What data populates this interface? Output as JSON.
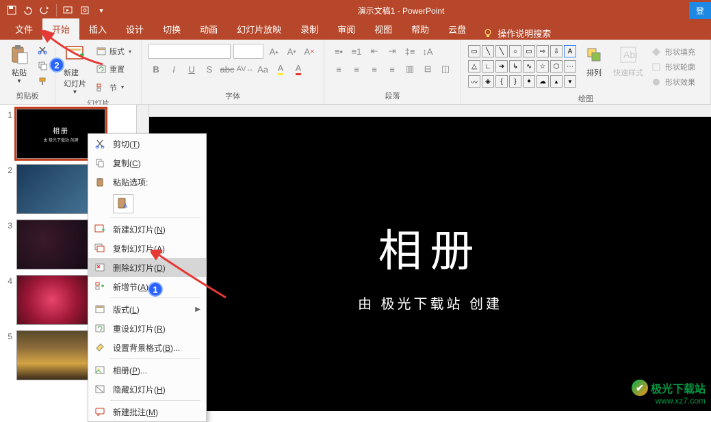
{
  "titlebar": {
    "title": "演示文稿1 - PowerPoint",
    "login": "登"
  },
  "tabs": {
    "file": "文件",
    "home": "开始",
    "insert": "插入",
    "design": "设计",
    "transitions": "切换",
    "animations": "动画",
    "slideshow": "幻灯片放映",
    "record": "录制",
    "review": "审阅",
    "view": "视图",
    "help": "帮助",
    "cloud": "云盘",
    "tellme": "操作说明搜索"
  },
  "ribbon": {
    "clipboard": {
      "label": "剪贴板",
      "paste": "粘贴"
    },
    "slides": {
      "label": "幻灯片",
      "newslide": "新建\n幻灯片",
      "layout": "版式",
      "reset": "重置",
      "section": "节"
    },
    "font": {
      "label": "字体"
    },
    "paragraph": {
      "label": "段落"
    },
    "drawing": {
      "label": "绘图",
      "arrange": "排列",
      "quickstyles": "快速样式",
      "fill": "形状填充",
      "outline": "形状轮廓",
      "effects": "形状效果"
    }
  },
  "slides": [
    {
      "num": "1",
      "title": "相册",
      "sub": "由 极光下载站 创建"
    },
    {
      "num": "2"
    },
    {
      "num": "3"
    },
    {
      "num": "4"
    },
    {
      "num": "5"
    }
  ],
  "canvas": {
    "title": "相册",
    "subtitle": "由 极光下载站 创建"
  },
  "ctx": {
    "cut": "剪切",
    "cut_k": "T",
    "copy": "复制",
    "copy_k": "C",
    "pasteopts": "粘贴选项:",
    "newslide": "新建幻灯片",
    "newslide_k": "N",
    "dupslide": "复制幻灯片",
    "dupslide_k": "A",
    "delslide": "删除幻灯片",
    "delslide_k": "D",
    "addsection": "新增节",
    "addsection_k": "A",
    "layout": "版式",
    "layout_k": "L",
    "resetslide": "重设幻灯片",
    "resetslide_k": "R",
    "formatbg": "设置背景格式",
    "formatbg_k": "B",
    "album": "相册",
    "album_k": "P",
    "hideslide": "隐藏幻灯片",
    "hideslide_k": "H",
    "newcomment": "新建批注",
    "newcomment_k": "M"
  },
  "annotations": {
    "badge1": "1",
    "badge2": "2"
  },
  "watermark": {
    "name": "极光下载站",
    "url": "www.xz7.com"
  }
}
